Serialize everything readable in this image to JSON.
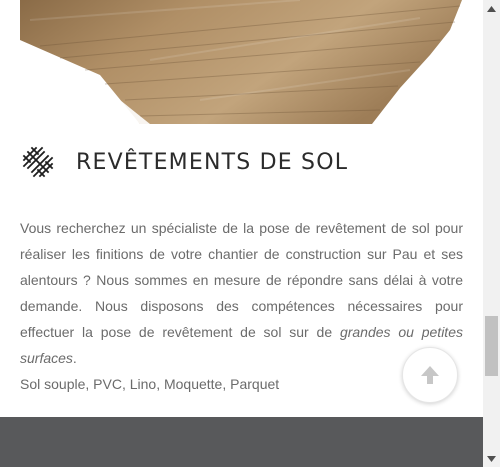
{
  "section": {
    "title": "REVÊTEMENTS DE SOL",
    "paragraph_main": "Vous recherchez un spécialiste de la pose de revêtement de sol pour réaliser les finitions de votre chantier de construction sur Pau et ses alentours ? Nous sommes en mesure de répondre sans délai à votre demande. Nous disposons des compétences nécessaires pour effectuer la pose de revêtement de sol sur de ",
    "paragraph_emphasis": "grandes ou petites surfaces",
    "paragraph_end": ".",
    "materials_list": "Sol souple, PVC, Lino, Moquette, Parquet"
  },
  "icons": {
    "section_icon": "parquet-pattern-icon",
    "scroll_top_icon": "arrow-up-icon"
  },
  "colors": {
    "title": "#2b2b2b",
    "body_text": "#6b6b6b",
    "footer": "#58595b",
    "wood": "#a8865d"
  }
}
